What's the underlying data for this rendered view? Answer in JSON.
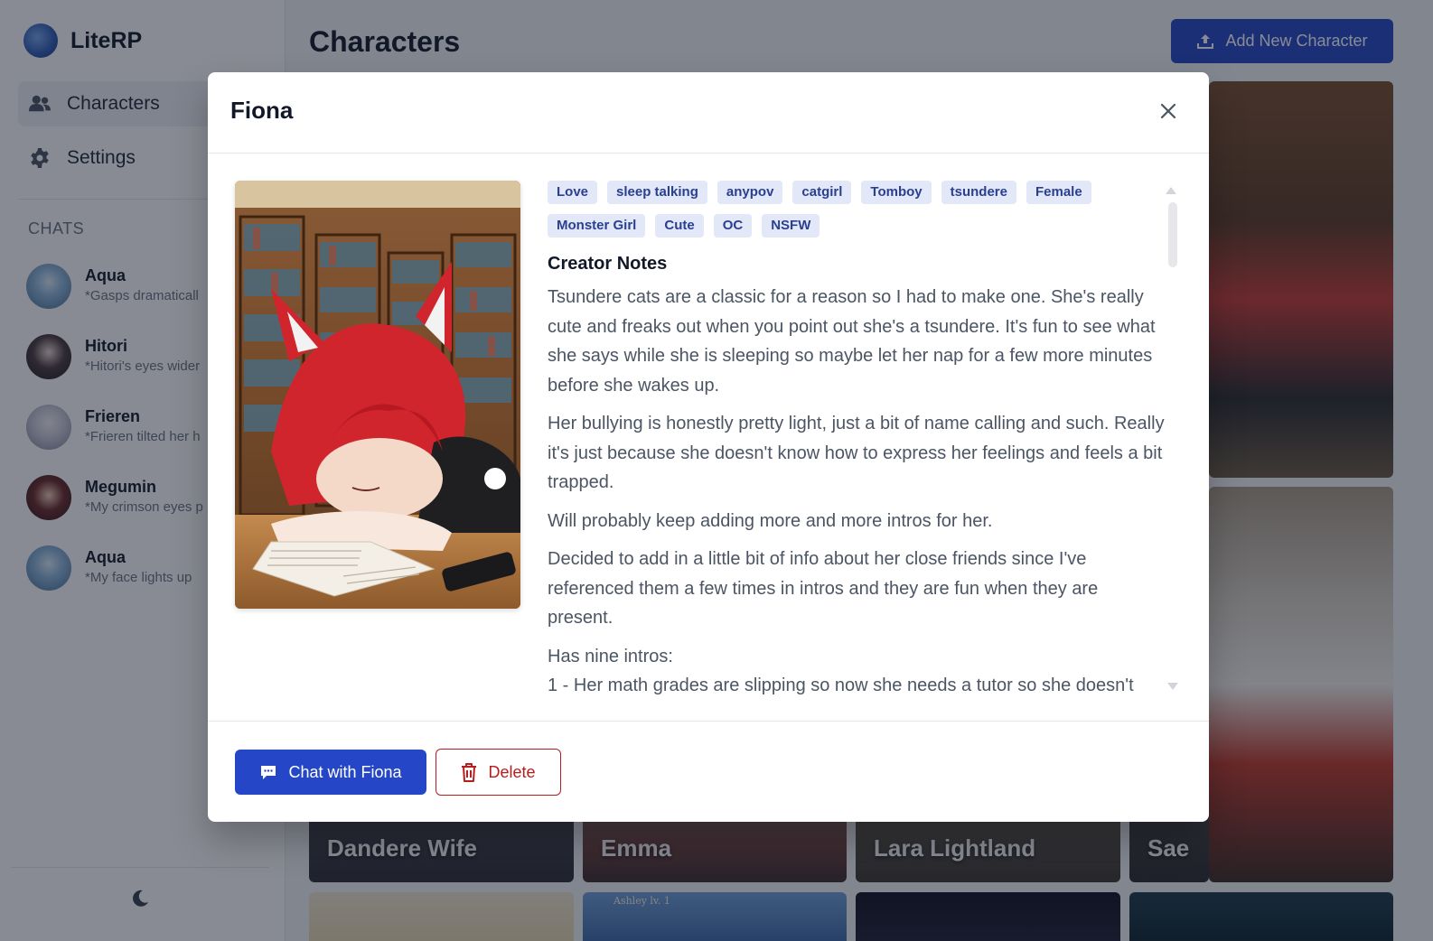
{
  "app": {
    "name": "LiteRP"
  },
  "nav": {
    "characters": "Characters",
    "settings": "Settings"
  },
  "chats": {
    "heading": "CHATS",
    "items": [
      {
        "name": "Aqua",
        "preview": "*Gasps dramaticall"
      },
      {
        "name": "Hitori",
        "preview": "*Hitori's eyes wider"
      },
      {
        "name": "Frieren",
        "preview": "*Frieren tilted her h"
      },
      {
        "name": "Megumin",
        "preview": "*My crimson eyes p"
      },
      {
        "name": "Aqua",
        "preview": "*My face lights up"
      }
    ]
  },
  "main": {
    "title": "Characters",
    "add_button": "Add New Character"
  },
  "cards": {
    "row2": [
      "Dandere Wife",
      "Emma",
      "Lara Lightland",
      "Sae"
    ],
    "overlay_text": "Ashley lv. 1"
  },
  "modal": {
    "title": "Fiona",
    "tags": [
      "Love",
      "sleep talking",
      "anypov",
      "catgirl",
      "Tomboy",
      "tsundere",
      "Female",
      "Monster Girl",
      "Cute",
      "OC",
      "NSFW"
    ],
    "notes_heading": "Creator Notes",
    "paragraphs": [
      "Tsundere cats are a classic for a reason so I had to make one. She's really cute and freaks out when you point out she's a tsundere. It's fun to see what she says while she is sleeping so maybe let her nap for a few more minutes before she wakes up.",
      "Her bullying is honestly pretty light, just a bit of name calling and such. Really it's just because she doesn't know how to express her feelings and feels a bit trapped.",
      "Will probably keep adding more and more intros for her.",
      "Decided to add in a little bit of info about her close friends since I've referenced them a few times in intros and they are fun when they are present."
    ],
    "intros_heading": "Has nine intros:",
    "intro_1": "1 - Her math grades are slipping so now she needs a tutor so she doesn't",
    "chat_button": "Chat with Fiona",
    "delete_button": "Delete"
  },
  "colors": {
    "accent": "#2547c7",
    "danger": "#b91c1c",
    "tag_bg": "#e2e8f8",
    "tag_text": "#2a3f8f"
  },
  "icons": {
    "logo": "globe-logo-icon",
    "characters": "users-icon",
    "settings": "gear-icon",
    "theme": "moon-icon",
    "add": "upload-icon",
    "close": "close-icon",
    "chat": "chat-bubble-icon",
    "delete": "trash-icon"
  }
}
